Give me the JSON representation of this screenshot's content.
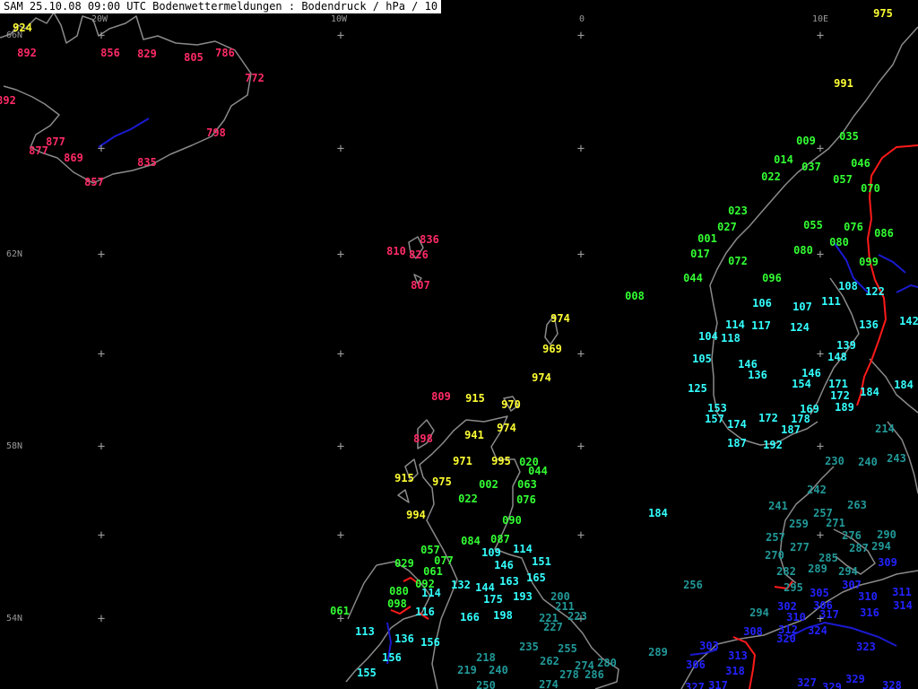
{
  "header": {
    "title": "SAM 25.10.08 09:00 UTC  Bodenwettermeldungen :  Bodendruck / hPa / 10"
  },
  "colors": {
    "red": "#ff2a66",
    "yellow": "#ffff33",
    "green": "#33ff33",
    "cyan": "#33ffff",
    "teal": "#229999",
    "blue": "#2222ff"
  },
  "axes": {
    "lon_labels": [
      "20W",
      "10W",
      "0",
      "10E"
    ],
    "lat_labels": [
      "66N",
      "62N",
      "58N",
      "54N"
    ]
  },
  "stations": [
    {
      "v": "924",
      "c": "yellow"
    },
    {
      "v": "892",
      "c": "red"
    },
    {
      "v": "856",
      "c": "red"
    },
    {
      "v": "829",
      "c": "red"
    },
    {
      "v": "805",
      "c": "red"
    },
    {
      "v": "786",
      "c": "red"
    },
    {
      "v": "772",
      "c": "red"
    },
    {
      "v": "892",
      "c": "red"
    },
    {
      "v": "798",
      "c": "red"
    },
    {
      "v": "877",
      "c": "red"
    },
    {
      "v": "877",
      "c": "red"
    },
    {
      "v": "869",
      "c": "red"
    },
    {
      "v": "835",
      "c": "red"
    },
    {
      "v": "857",
      "c": "red"
    },
    {
      "v": "836",
      "c": "red"
    },
    {
      "v": "810",
      "c": "red"
    },
    {
      "v": "826",
      "c": "red"
    },
    {
      "v": "807",
      "c": "red"
    },
    {
      "v": "809",
      "c": "red"
    },
    {
      "v": "898",
      "c": "red"
    },
    {
      "v": "974",
      "c": "yellow"
    },
    {
      "v": "969",
      "c": "yellow"
    },
    {
      "v": "974",
      "c": "yellow"
    },
    {
      "v": "915",
      "c": "yellow"
    },
    {
      "v": "970",
      "c": "yellow"
    },
    {
      "v": "974",
      "c": "yellow"
    },
    {
      "v": "941",
      "c": "yellow"
    },
    {
      "v": "971",
      "c": "yellow"
    },
    {
      "v": "995",
      "c": "yellow"
    },
    {
      "v": "915",
      "c": "yellow"
    },
    {
      "v": "975",
      "c": "yellow"
    },
    {
      "v": "994",
      "c": "yellow"
    },
    {
      "v": "975",
      "c": "yellow"
    },
    {
      "v": "991",
      "c": "yellow"
    },
    {
      "v": "008",
      "c": "green"
    },
    {
      "v": "020",
      "c": "green"
    },
    {
      "v": "044",
      "c": "green"
    },
    {
      "v": "002",
      "c": "green"
    },
    {
      "v": "063",
      "c": "green"
    },
    {
      "v": "022",
      "c": "green"
    },
    {
      "v": "076",
      "c": "green"
    },
    {
      "v": "090",
      "c": "green"
    },
    {
      "v": "087",
      "c": "green"
    },
    {
      "v": "084",
      "c": "green"
    },
    {
      "v": "057",
      "c": "green"
    },
    {
      "v": "077",
      "c": "green"
    },
    {
      "v": "029",
      "c": "green"
    },
    {
      "v": "061",
      "c": "green"
    },
    {
      "v": "092",
      "c": "green"
    },
    {
      "v": "080",
      "c": "green"
    },
    {
      "v": "098",
      "c": "green"
    },
    {
      "v": "061",
      "c": "green"
    },
    {
      "v": "009",
      "c": "green"
    },
    {
      "v": "035",
      "c": "green"
    },
    {
      "v": "014",
      "c": "green"
    },
    {
      "v": "037",
      "c": "green"
    },
    {
      "v": "046",
      "c": "green"
    },
    {
      "v": "022",
      "c": "green"
    },
    {
      "v": "057",
      "c": "green"
    },
    {
      "v": "070",
      "c": "green"
    },
    {
      "v": "023",
      "c": "green"
    },
    {
      "v": "027",
      "c": "green"
    },
    {
      "v": "055",
      "c": "green"
    },
    {
      "v": "076",
      "c": "green"
    },
    {
      "v": "086",
      "c": "green"
    },
    {
      "v": "001",
      "c": "green"
    },
    {
      "v": "080",
      "c": "green"
    },
    {
      "v": "080",
      "c": "green"
    },
    {
      "v": "017",
      "c": "green"
    },
    {
      "v": "072",
      "c": "green"
    },
    {
      "v": "099",
      "c": "green"
    },
    {
      "v": "044",
      "c": "green"
    },
    {
      "v": "096",
      "c": "green"
    },
    {
      "v": "108",
      "c": "cyan"
    },
    {
      "v": "122",
      "c": "cyan"
    },
    {
      "v": "106",
      "c": "cyan"
    },
    {
      "v": "107",
      "c": "cyan"
    },
    {
      "v": "111",
      "c": "cyan"
    },
    {
      "v": "114",
      "c": "cyan"
    },
    {
      "v": "117",
      "c": "cyan"
    },
    {
      "v": "124",
      "c": "cyan"
    },
    {
      "v": "136",
      "c": "cyan"
    },
    {
      "v": "142",
      "c": "cyan"
    },
    {
      "v": "104",
      "c": "cyan"
    },
    {
      "v": "118",
      "c": "cyan"
    },
    {
      "v": "139",
      "c": "cyan"
    },
    {
      "v": "105",
      "c": "cyan"
    },
    {
      "v": "146",
      "c": "cyan"
    },
    {
      "v": "148",
      "c": "cyan"
    },
    {
      "v": "136",
      "c": "cyan"
    },
    {
      "v": "146",
      "c": "cyan"
    },
    {
      "v": "125",
      "c": "cyan"
    },
    {
      "v": "154",
      "c": "cyan"
    },
    {
      "v": "171",
      "c": "cyan"
    },
    {
      "v": "172",
      "c": "cyan"
    },
    {
      "v": "184",
      "c": "cyan"
    },
    {
      "v": "184",
      "c": "cyan"
    },
    {
      "v": "153",
      "c": "cyan"
    },
    {
      "v": "169",
      "c": "cyan"
    },
    {
      "v": "189",
      "c": "cyan"
    },
    {
      "v": "157",
      "c": "cyan"
    },
    {
      "v": "174",
      "c": "cyan"
    },
    {
      "v": "172",
      "c": "cyan"
    },
    {
      "v": "178",
      "c": "cyan"
    },
    {
      "v": "187",
      "c": "cyan"
    },
    {
      "v": "187",
      "c": "cyan"
    },
    {
      "v": "192",
      "c": "cyan"
    },
    {
      "v": "184",
      "c": "cyan"
    },
    {
      "v": "109",
      "c": "cyan"
    },
    {
      "v": "114",
      "c": "cyan"
    },
    {
      "v": "146",
      "c": "cyan"
    },
    {
      "v": "151",
      "c": "cyan"
    },
    {
      "v": "163",
      "c": "cyan"
    },
    {
      "v": "165",
      "c": "cyan"
    },
    {
      "v": "114",
      "c": "cyan"
    },
    {
      "v": "132",
      "c": "cyan"
    },
    {
      "v": "144",
      "c": "cyan"
    },
    {
      "v": "175",
      "c": "cyan"
    },
    {
      "v": "193",
      "c": "cyan"
    },
    {
      "v": "116",
      "c": "cyan"
    },
    {
      "v": "166",
      "c": "cyan"
    },
    {
      "v": "198",
      "c": "cyan"
    },
    {
      "v": "113",
      "c": "cyan"
    },
    {
      "v": "136",
      "c": "cyan"
    },
    {
      "v": "156",
      "c": "cyan"
    },
    {
      "v": "156",
      "c": "cyan"
    },
    {
      "v": "155",
      "c": "cyan"
    },
    {
      "v": "214",
      "c": "teal"
    },
    {
      "v": "230",
      "c": "teal"
    },
    {
      "v": "240",
      "c": "teal"
    },
    {
      "v": "243",
      "c": "teal"
    },
    {
      "v": "242",
      "c": "teal"
    },
    {
      "v": "241",
      "c": "teal"
    },
    {
      "v": "263",
      "c": "teal"
    },
    {
      "v": "257",
      "c": "teal"
    },
    {
      "v": "259",
      "c": "teal"
    },
    {
      "v": "271",
      "c": "teal"
    },
    {
      "v": "257",
      "c": "teal"
    },
    {
      "v": "276",
      "c": "teal"
    },
    {
      "v": "290",
      "c": "teal"
    },
    {
      "v": "277",
      "c": "teal"
    },
    {
      "v": "287",
      "c": "teal"
    },
    {
      "v": "294",
      "c": "teal"
    },
    {
      "v": "270",
      "c": "teal"
    },
    {
      "v": "285",
      "c": "teal"
    },
    {
      "v": "282",
      "c": "teal"
    },
    {
      "v": "289",
      "c": "teal"
    },
    {
      "v": "294",
      "c": "teal"
    },
    {
      "v": "295",
      "c": "teal"
    },
    {
      "v": "256",
      "c": "teal"
    },
    {
      "v": "200",
      "c": "teal"
    },
    {
      "v": "211",
      "c": "teal"
    },
    {
      "v": "221",
      "c": "teal"
    },
    {
      "v": "223",
      "c": "teal"
    },
    {
      "v": "227",
      "c": "teal"
    },
    {
      "v": "294",
      "c": "teal"
    },
    {
      "v": "235",
      "c": "teal"
    },
    {
      "v": "255",
      "c": "teal"
    },
    {
      "v": "289",
      "c": "teal"
    },
    {
      "v": "218",
      "c": "teal"
    },
    {
      "v": "262",
      "c": "teal"
    },
    {
      "v": "274",
      "c": "teal"
    },
    {
      "v": "280",
      "c": "teal"
    },
    {
      "v": "219",
      "c": "teal"
    },
    {
      "v": "240",
      "c": "teal"
    },
    {
      "v": "278",
      "c": "teal"
    },
    {
      "v": "286",
      "c": "teal"
    },
    {
      "v": "250",
      "c": "teal"
    },
    {
      "v": "274",
      "c": "teal"
    },
    {
      "v": "309",
      "c": "blue"
    },
    {
      "v": "305",
      "c": "blue"
    },
    {
      "v": "307",
      "c": "blue"
    },
    {
      "v": "310",
      "c": "blue"
    },
    {
      "v": "311",
      "c": "blue"
    },
    {
      "v": "302",
      "c": "blue"
    },
    {
      "v": "306",
      "c": "blue"
    },
    {
      "v": "314",
      "c": "blue"
    },
    {
      "v": "310",
      "c": "blue"
    },
    {
      "v": "317",
      "c": "blue"
    },
    {
      "v": "316",
      "c": "blue"
    },
    {
      "v": "308",
      "c": "blue"
    },
    {
      "v": "312",
      "c": "blue"
    },
    {
      "v": "324",
      "c": "blue"
    },
    {
      "v": "320",
      "c": "blue"
    },
    {
      "v": "303",
      "c": "blue"
    },
    {
      "v": "313",
      "c": "blue"
    },
    {
      "v": "323",
      "c": "blue"
    },
    {
      "v": "306",
      "c": "blue"
    },
    {
      "v": "318",
      "c": "blue"
    },
    {
      "v": "327",
      "c": "blue"
    },
    {
      "v": "329",
      "c": "blue"
    },
    {
      "v": "328",
      "c": "blue"
    },
    {
      "v": "317",
      "c": "blue"
    },
    {
      "v": "329",
      "c": "blue"
    },
    {
      "v": "327",
      "c": "blue"
    }
  ]
}
